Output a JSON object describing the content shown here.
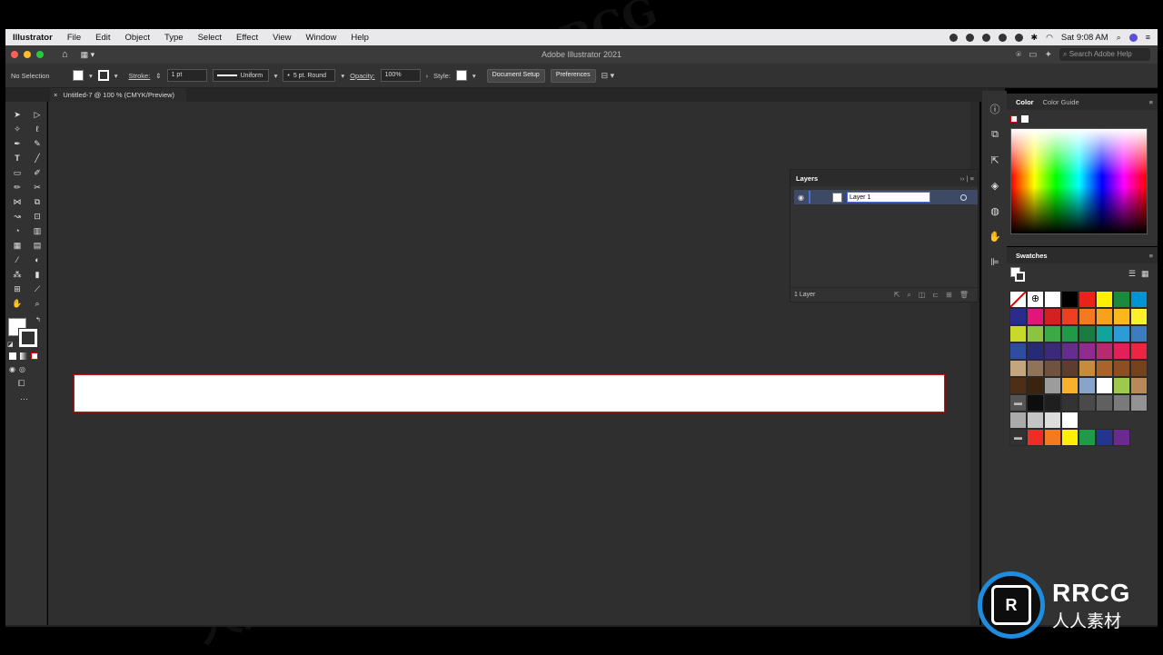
{
  "menubar": {
    "app": "Illustrator",
    "items": [
      "File",
      "Edit",
      "Object",
      "Type",
      "Select",
      "Effect",
      "View",
      "Window",
      "Help"
    ],
    "clock": "Sat 9:08 AM"
  },
  "titlebar": {
    "title": "Adobe Illustrator 2021",
    "search_placeholder": "Search Adobe Help"
  },
  "control": {
    "selection": "No Selection",
    "stroke_label": "Stroke:",
    "stroke_weight": "1 pt",
    "profile": "Uniform",
    "brush": "5 pt. Round",
    "opacity_label": "Opacity:",
    "opacity": "100%",
    "style_label": "Style:",
    "doc_setup": "Document Setup",
    "preferences": "Preferences"
  },
  "document": {
    "tab": "Untitled-7 @ 100 % (CMYK/Preview)"
  },
  "panels": {
    "color_tab": "Color",
    "color_guide_tab": "Color Guide",
    "swatches_tab": "Swatches"
  },
  "layers": {
    "title": "Layers",
    "layer_name": "Layer 1",
    "count": "1 Layer"
  },
  "swatches": {
    "rows": [
      [
        "#ffffff",
        "#ffffff",
        "#ffffff",
        "#000000",
        "#e8231b",
        "#fef000",
        "#1a8a3c",
        "#0094d2"
      ],
      [
        "#2b2b8c",
        "#e2157a",
        "#d4201f",
        "#ef3f23",
        "#f47920",
        "#f7a21b",
        "#fbb81c",
        "#fdef2b"
      ],
      [
        "#c9d92b",
        "#8cc43f",
        "#3aa946",
        "#1e9a48",
        "#1c7a43",
        "#11a49d",
        "#2c9bd6",
        "#3c7cc0"
      ],
      [
        "#2e4da0",
        "#262a77",
        "#3b2a7a",
        "#652d90",
        "#912c8e",
        "#b62b6d",
        "#e2215b",
        "#ed2640"
      ],
      [
        "#c3a57e",
        "#8f7458",
        "#70533f",
        "#5d3d2d",
        "#c68b3c",
        "#a8652b",
        "#8b4f23",
        "#74431e"
      ],
      [
        "#4d2e17",
        "#3a2410",
        "#9c9c9c",
        "#f9b12d",
        "#8aa3c8",
        "#ffffff",
        "#9cc94e",
        "#b98a59"
      ],
      [
        "#555555",
        "#0d0d0d",
        "#1f1f1f",
        "#333333",
        "#4a4a4a",
        "#606060",
        "#7a7a7a",
        "#939393"
      ]
    ],
    "row_grays": [
      "#aaaaaa",
      "#c4c4c4",
      "#dddddd",
      "#ffffff"
    ],
    "row_bright": [
      "#ee2e24",
      "#f47a20",
      "#fef000",
      "#1f9a4a",
      "#23358f",
      "#6a2a8e"
    ]
  },
  "brand": {
    "logo_text": "RRCG",
    "logo_sub": "人人素材",
    "watermark_latin": "RRCG",
    "watermark_cjk": "人人素材",
    "accent": "#1e8de0"
  }
}
